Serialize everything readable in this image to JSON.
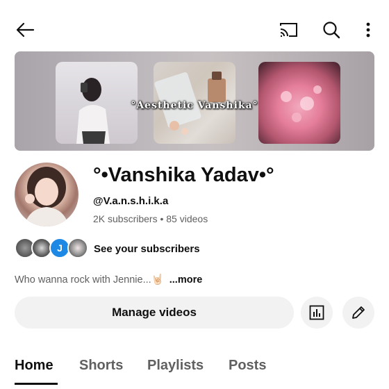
{
  "header": {
    "icons": [
      "arrow-left-icon",
      "cast-icon",
      "search-icon",
      "more-vertical-icon"
    ]
  },
  "banner": {
    "title": "°Aesthetic Vanshika°"
  },
  "channel": {
    "name": "°•Vanshika Yadav•°",
    "handle": "@V.a.n.s.h.i.k.a",
    "stats": "2K subscribers • 85 videos",
    "subscriber_avatar_letter": "J",
    "see_subscribers": "See your subscribers",
    "description": "Who wanna rock with Jennie...🤘🏻",
    "description_more": "...more"
  },
  "actions": {
    "manage_videos": "Manage videos",
    "icons": [
      "analytics-icon",
      "edit-pencil-icon"
    ]
  },
  "tabs": [
    {
      "label": "Home",
      "active": true
    },
    {
      "label": "Shorts",
      "active": false
    },
    {
      "label": "Playlists",
      "active": false
    },
    {
      "label": "Posts",
      "active": false
    }
  ],
  "colors": {
    "text_primary": "#0f0f0f",
    "text_secondary": "#606060",
    "button_bg": "#f2f2f2",
    "subscriber_badge": "#1e88e5"
  }
}
